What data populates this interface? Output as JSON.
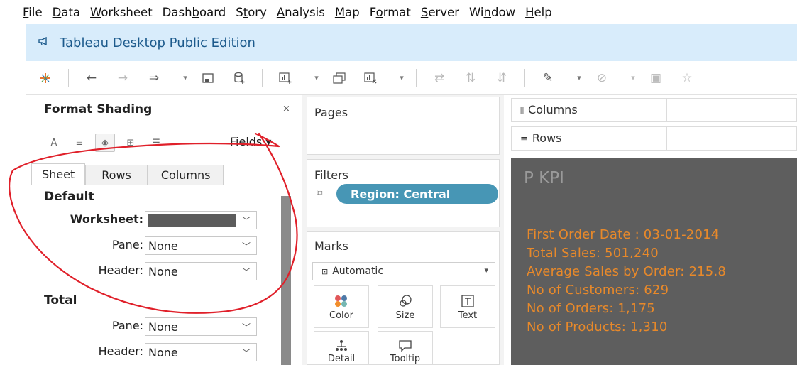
{
  "menu": {
    "items": [
      {
        "label": "File",
        "mn": "F",
        "rest": "ile"
      },
      {
        "label": "Data",
        "mn": "D",
        "rest": "ata"
      },
      {
        "label": "Worksheet",
        "mn": "W",
        "rest": "orksheet"
      },
      {
        "label": "Dashboard",
        "pre": "Dash",
        "mn": "b",
        "rest": "oard"
      },
      {
        "label": "Story",
        "pre": "S",
        "mn": "t",
        "rest": "ory"
      },
      {
        "label": "Analysis",
        "mn": "A",
        "rest": "nalysis"
      },
      {
        "label": "Map",
        "mn": "M",
        "rest": "ap"
      },
      {
        "label": "Format",
        "pre": "F",
        "mn": "o",
        "rest": "rmat"
      },
      {
        "label": "Server",
        "mn": "S",
        "rest": "erver"
      },
      {
        "label": "Window",
        "pre": "Wi",
        "mn": "n",
        "rest": "dow"
      },
      {
        "label": "Help",
        "mn": "H",
        "rest": "elp"
      }
    ]
  },
  "banner": {
    "title": "Tableau Desktop Public Edition",
    "icon": "megaphone-icon"
  },
  "format_panel": {
    "title": "Format Shading",
    "close": "×",
    "fields_label": "Fields",
    "tabs": [
      "Sheet",
      "Rows",
      "Columns"
    ],
    "active_tab": "Sheet",
    "default_section": "Default",
    "worksheet_label": "Worksheet:",
    "pane_label": "Pane:",
    "pane_value": "None",
    "header_label": "Header:",
    "header_value": "None",
    "total_section": "Total",
    "total_pane_label": "Pane:",
    "total_pane_value": "None",
    "total_header_label": "Header:",
    "total_header_value": "None",
    "worksheet_color": "#5c5c5c"
  },
  "cards": {
    "pages_title": "Pages",
    "filters_title": "Filters",
    "filter_pill": "Region: Central",
    "marks_title": "Marks",
    "mark_type": "Automatic",
    "mark_buttons": {
      "color": "Color",
      "size": "Size",
      "text": "Text",
      "detail": "Detail",
      "tooltip": "Tooltip"
    }
  },
  "shelves": {
    "columns_label": "Columns",
    "rows_label": "Rows"
  },
  "view": {
    "title": "P KPI",
    "kpis": [
      "First Order Date : 03-01-2014",
      "Total Sales: 501,240",
      "Average Sales by Order: 215.8",
      "No of Customers: 629",
      "No of Orders: 1,175",
      "No of Products: 1,310"
    ],
    "background": "#5e5e5e",
    "kpi_color": "#e8892a"
  },
  "colors": {
    "banner_bg": "#d8ecfb",
    "filter_pill": "#4796b5",
    "annotation": "#e0202a"
  }
}
